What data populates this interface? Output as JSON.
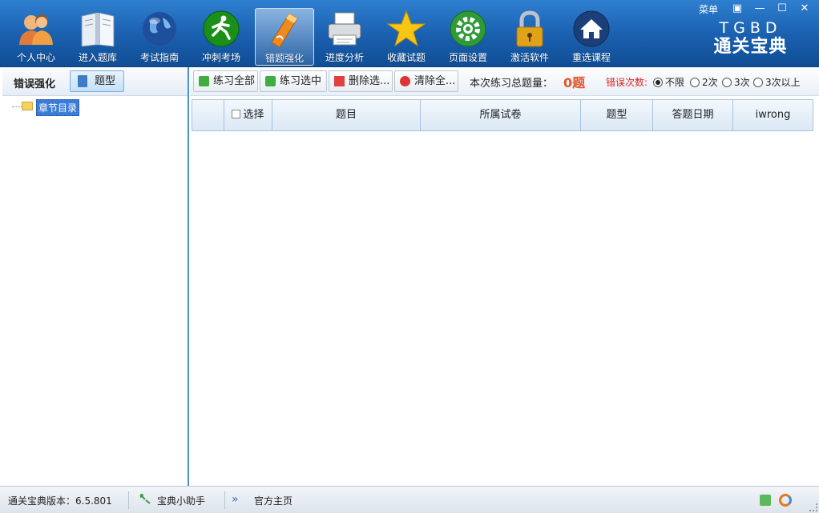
{
  "window": {
    "menu_label": "菜单",
    "controls": {
      "restore": "▣",
      "minimize": "—",
      "maximize": "☐",
      "close": "✕"
    }
  },
  "brand": {
    "en": "TGBD",
    "cn": "通关宝典"
  },
  "nav": [
    {
      "label": "个人中心",
      "icon": "users-icon"
    },
    {
      "label": "进入题库",
      "icon": "book-icon"
    },
    {
      "label": "考试指南",
      "icon": "globe-icon"
    },
    {
      "label": "冲刺考场",
      "icon": "runner-icon"
    },
    {
      "label": "错题强化",
      "icon": "pen-icon",
      "active": true
    },
    {
      "label": "进度分析",
      "icon": "printer-icon"
    },
    {
      "label": "收藏试题",
      "icon": "star-icon"
    },
    {
      "label": "页面设置",
      "icon": "gear-icon"
    },
    {
      "label": "激活软件",
      "icon": "lock-icon"
    },
    {
      "label": "重选课程",
      "icon": "home-icon"
    }
  ],
  "left": {
    "title": "错误强化",
    "type_button": "题型",
    "tree_root": "章节目录"
  },
  "toolbar": {
    "practice_all": "练习全部",
    "practice_selected": "练习选中",
    "delete_selected": "删除选...",
    "clear_all": "清除全...",
    "count_label": "本次练习总题量：",
    "count_value": "0题",
    "error_label": "错误次数:",
    "options": [
      "不限",
      "2次",
      "3次",
      "3次以上"
    ],
    "selected_option": "不限"
  },
  "table": {
    "columns": [
      "选择",
      "题目",
      "所属试卷",
      "题型",
      "答题日期",
      "iwrong"
    ]
  },
  "status": {
    "version": "通关宝典版本：6.5.801",
    "helper": "宝典小助手",
    "homepage": "官方主页"
  },
  "colors": {
    "accent": "#1a5fae",
    "count": "#e2552a",
    "error_label": "#dd2222"
  }
}
